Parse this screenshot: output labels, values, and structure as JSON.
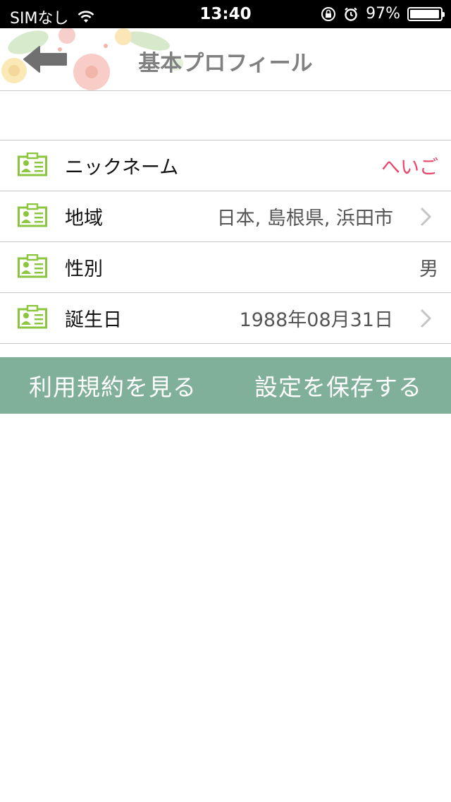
{
  "status_bar": {
    "carrier": "SIMなし",
    "time": "13:40",
    "battery_percent": "97%",
    "battery_level": 0.97,
    "icons": [
      "wifi-icon",
      "rotation-lock-icon",
      "alarm-icon",
      "battery-icon"
    ]
  },
  "nav": {
    "title": "基本プロフィール",
    "back_icon": "back-arrow-icon"
  },
  "rows": [
    {
      "label": "ニックネーム",
      "value": "へいご",
      "chevron": false
    },
    {
      "label": "地域",
      "value": "日本, 島根県, 浜田市",
      "chevron": true
    },
    {
      "label": "性別",
      "value": "男",
      "chevron": false
    },
    {
      "label": "誕生日",
      "value": "1988年08月31日",
      "chevron": true
    }
  ],
  "actions": {
    "terms": "利用規約を見る",
    "save": "設定を保存する"
  },
  "colors": {
    "accent_green": "#80b09a",
    "icon_green": "#8cc63f",
    "nickname_red": "#e8466c"
  }
}
